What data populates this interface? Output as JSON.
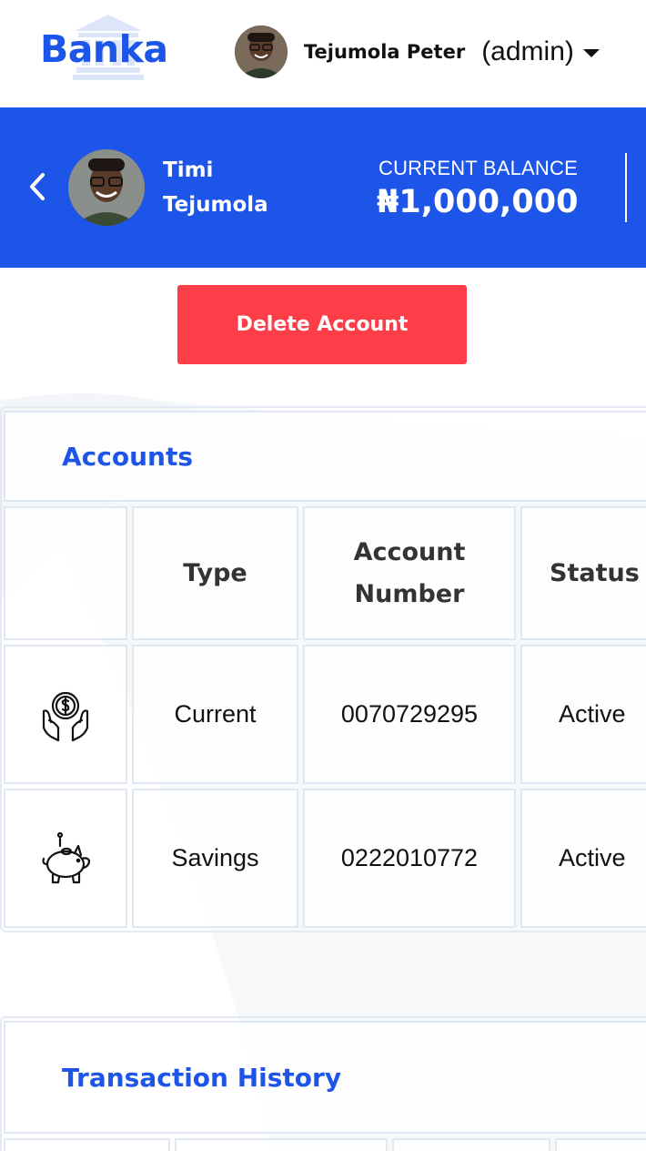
{
  "header": {
    "logo_text": "Banka",
    "user_name": "Tejumola Peter",
    "user_role": "(admin)",
    "brand_color": "#1d55e8"
  },
  "customer": {
    "first_name": "Timi",
    "last_name": "Tejumola",
    "balance_label": "CURRENT BALANCE",
    "balance_value": "₦1,000,000"
  },
  "actions": {
    "delete_label": "Delete Account",
    "delete_color": "#fd3e48"
  },
  "accounts": {
    "title": "Accounts",
    "columns": [
      "Type",
      "Account Number",
      "Status"
    ],
    "column_number_line1": "Account",
    "column_number_line2": "Number",
    "rows": [
      {
        "icon": "money-hands-icon",
        "type": "Current",
        "number": "0070729295",
        "status": "Active"
      },
      {
        "icon": "piggy-bank-icon",
        "type": "Savings",
        "number": "0222010772",
        "status": "Active"
      }
    ]
  },
  "transactions": {
    "title": "Transaction History"
  }
}
